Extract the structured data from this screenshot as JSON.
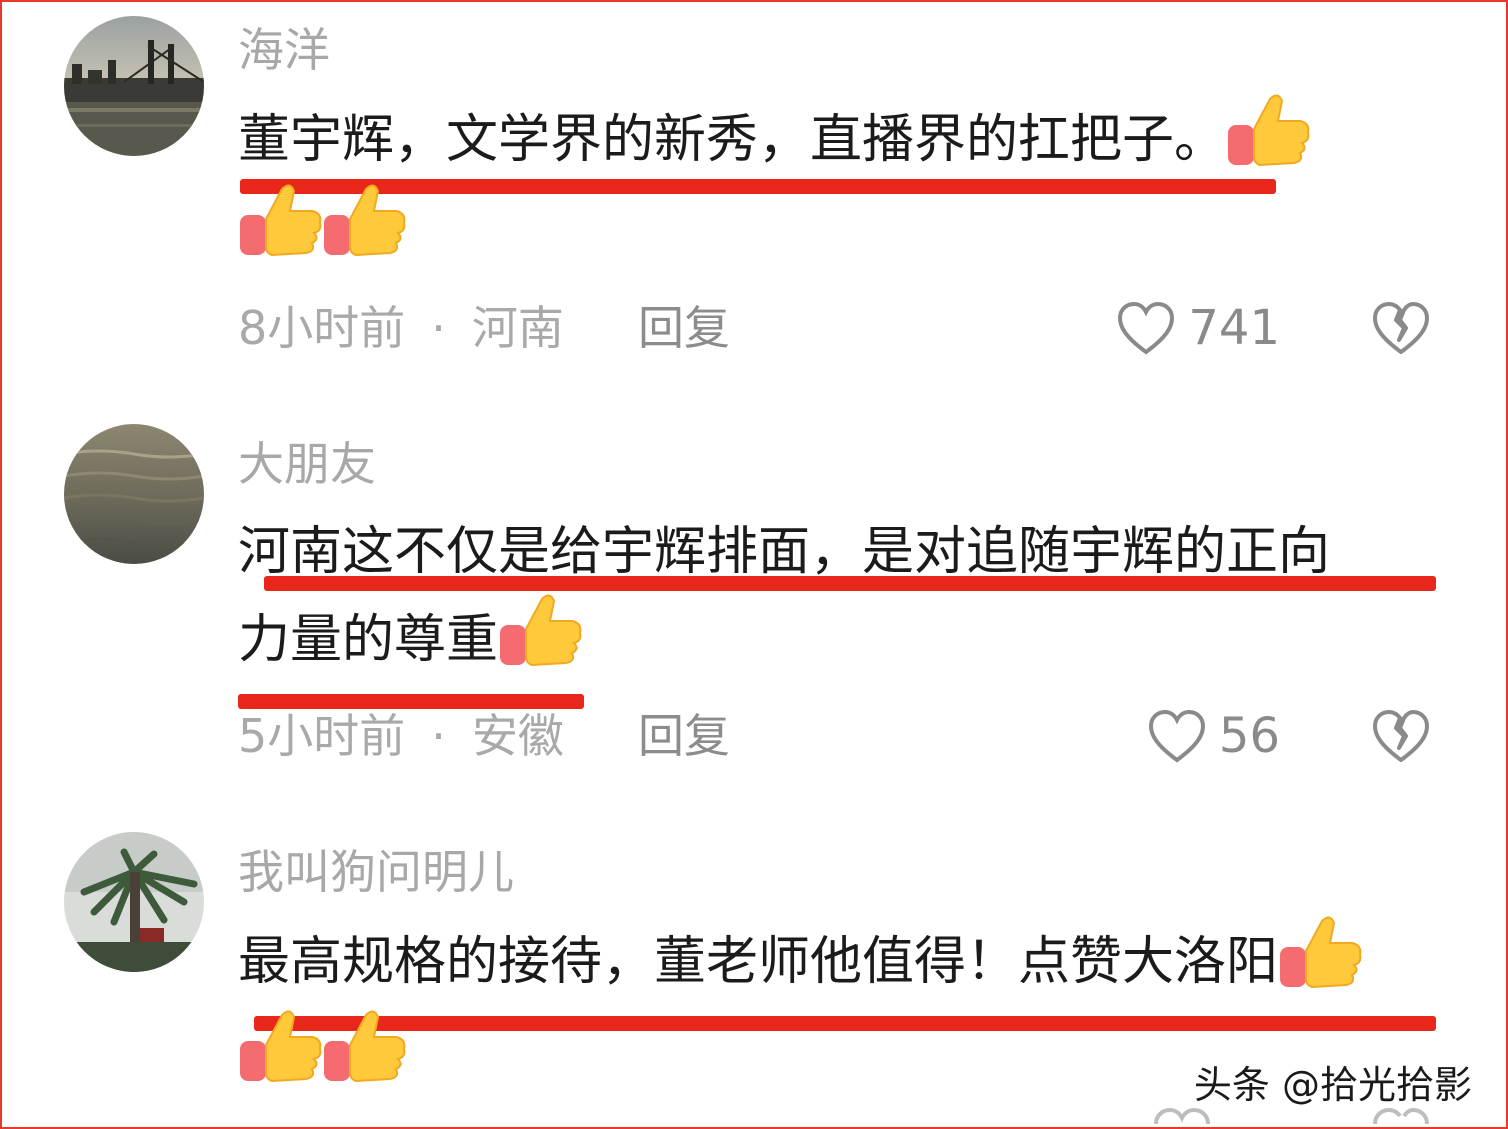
{
  "comments": [
    {
      "username": "海洋",
      "text_line1": "董宇辉，文学界的新秀，直播界的扛把子。",
      "meta_time": "8小时前",
      "meta_location": "河南",
      "reply_label": "回复",
      "like_count": "741"
    },
    {
      "username": "大朋友",
      "text_line1": "河南这不仅是给宇辉排面，是对追随宇辉的正向",
      "text_line2": "力量的尊重",
      "meta_time": "5小时前",
      "meta_location": "安徽",
      "reply_label": "回复",
      "like_count": "56"
    },
    {
      "username": "我叫狗问明儿",
      "text_line1": "最高规格的接待，董老师他值得！点赞大洛阳"
    }
  ],
  "watermark": "头条 @拾光拾影",
  "colors": {
    "underline": "#e8261a",
    "frame_border": "#e8392b",
    "thumb_yellow": "#ffc93c",
    "thumb_cuff": "#f56c70"
  },
  "icons": [
    "thumbs-up-emoji",
    "heart-outline-icon",
    "broken-heart-icon"
  ]
}
